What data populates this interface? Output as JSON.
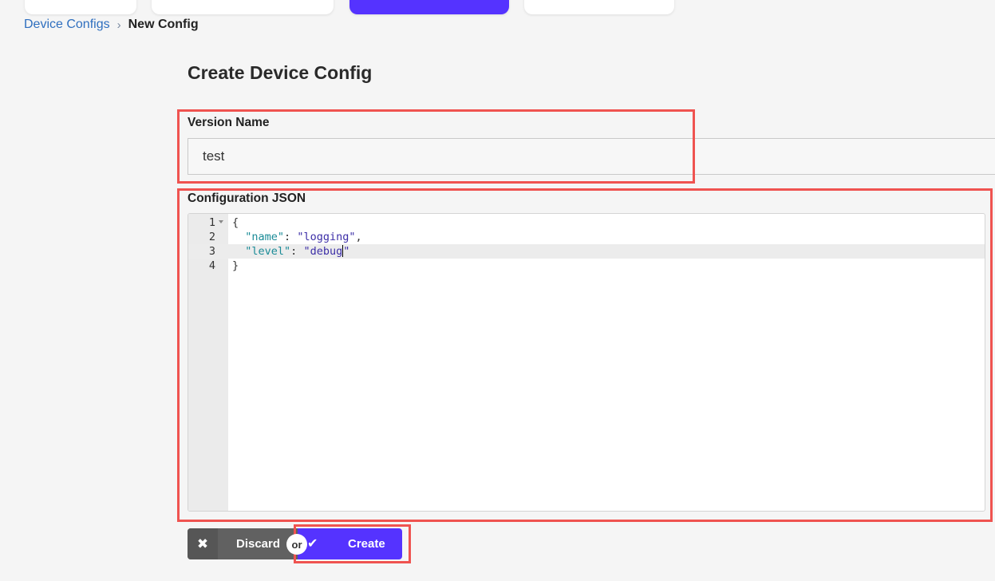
{
  "breadcrumb": {
    "parent": "Device Configs",
    "separator": "›",
    "current": "New Config"
  },
  "page_title": "Create Device Config",
  "version_field": {
    "label": "Version Name",
    "value": "test"
  },
  "config_field": {
    "label": "Configuration JSON",
    "editor": {
      "line_numbers": [
        "1",
        "2",
        "3",
        "4"
      ],
      "active_line": 3,
      "lines": [
        {
          "text": "{"
        },
        {
          "key": "\"name\"",
          "sep": ": ",
          "value": "\"logging\"",
          "tail": ","
        },
        {
          "key": "\"level\"",
          "sep": ": ",
          "value": "\"debug",
          "tail": "\""
        },
        {
          "text": "}"
        }
      ]
    }
  },
  "actions": {
    "discard_icon": "close-icon",
    "discard_label": "Discard",
    "or_label": "or",
    "create_icon": "check-icon",
    "create_label": "Create"
  },
  "colors": {
    "primary": "#5533ff",
    "highlight": "#ef5350",
    "link": "#2f6fbf"
  }
}
